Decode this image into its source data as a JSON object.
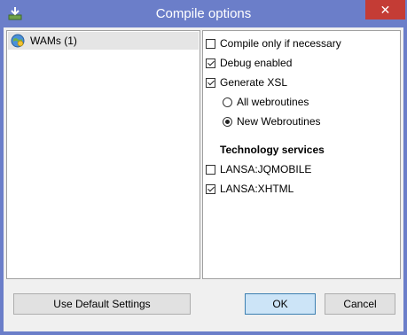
{
  "window": {
    "title": "Compile options",
    "close_glyph": "✕",
    "title_icon": "compile-icon"
  },
  "tree": {
    "items": [
      {
        "label": "WAMs (1)",
        "icon": "globe-icon",
        "selected": true
      }
    ]
  },
  "options": {
    "compile_only": {
      "label": "Compile only if necessary",
      "checked": false
    },
    "debug": {
      "label": "Debug enabled",
      "checked": true
    },
    "generate_xsl": {
      "label": "Generate XSL",
      "checked": true
    },
    "all_webroutines": {
      "label": "All webroutines",
      "selected": false
    },
    "new_webroutines": {
      "label": "New Webroutines",
      "selected": true
    }
  },
  "technology": {
    "heading": "Technology services",
    "items": [
      {
        "label": "LANSA:JQMOBILE",
        "checked": false
      },
      {
        "label": "LANSA:XHTML",
        "checked": true
      }
    ]
  },
  "buttons": {
    "defaults": "Use Default Settings",
    "ok": "OK",
    "cancel": "Cancel"
  },
  "colors": {
    "titlebar": "#6b7ec9",
    "close": "#c43c35",
    "default_button": "#cce4f7"
  }
}
